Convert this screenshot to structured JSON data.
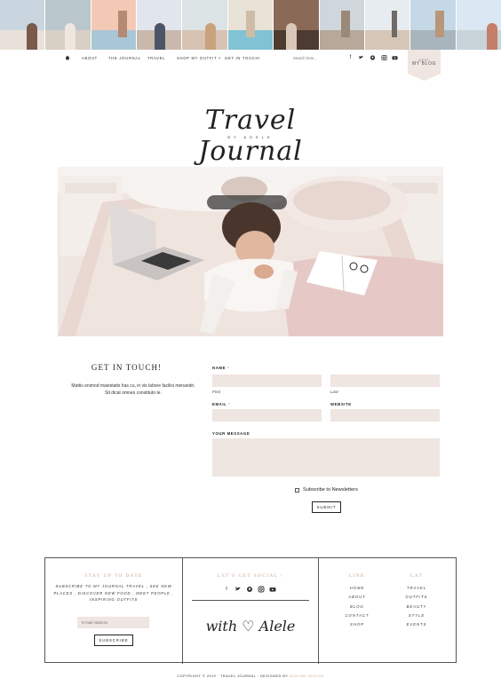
{
  "nav": {
    "items": [
      "ABOUT",
      "THE JOURNAL",
      "TRAVEL",
      "SHOP MY OUTFIT",
      "GET IN TOUCH!"
    ],
    "search_placeholder": "Search here...",
    "badge_small": "NEXT",
    "badge_label": "MY BLOG",
    "icons": [
      "home-icon",
      "facebook-icon",
      "twitter-icon",
      "pinterest-icon",
      "instagram-icon",
      "youtube-icon"
    ]
  },
  "header": {
    "logo": "Travel Journal",
    "logo_sub": "BY ADELE"
  },
  "contact": {
    "title": "GET IN TOUCH!",
    "text": "Mattis enimod maiestatis has cu, in vis labore facilisi menandri. Sit dicat omnes constituto te.",
    "name_label": "NAME",
    "first_label": "First",
    "last_label": "Last",
    "email_label": "EMAIL",
    "website_label": "WEBSITE",
    "message_label": "YOUR MESSAGE",
    "required_mark": "*",
    "subscribe_label": "Subscribe to Newsletters",
    "submit_label": "SUBMIT"
  },
  "footer": {
    "stay_title": "STAY UP TO DATE",
    "stay_text": "SUBSCRIBE TO MY JOURNAL TRAVEL , SEE NEW PLACES , DISCOVER NEW FOOD , MEET PEOPLE , INSPIRING OUTFITS",
    "email_placeholder": "E-mail Address",
    "subscribe_label": "SUBSCRIBE",
    "social_title": "LET'S GET SOCIAL !",
    "signature": "with ♡ Alele",
    "link_title": "LINK",
    "links": [
      "HOME",
      "ABOUT",
      "BLOG",
      "CONTACT",
      "SHOP"
    ],
    "cat_title": "CAT",
    "cats": [
      "TRAVEL",
      "OUTFITS",
      "BEAUTY",
      "STYLE",
      "EVENTS"
    ]
  },
  "copyright": {
    "prefix": "COPYRIGHT © 2019 · TRAVEL JOURNAL · DESIGNED BY",
    "designer": "ADALINE DESIGN"
  },
  "colors": {
    "accent": "#c9a795",
    "field": "#efe5e1",
    "text": "#333333"
  }
}
